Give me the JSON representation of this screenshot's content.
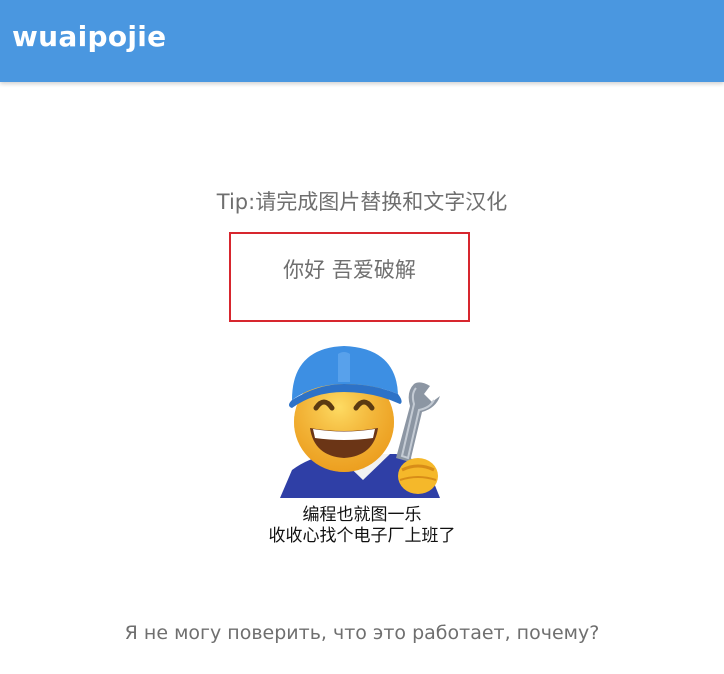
{
  "app_bar": {
    "title": "wuaipojie",
    "background_color": "#4a97e0"
  },
  "main": {
    "tip": "Tip:请完成图片替换和文字汉化",
    "greeting": "你好 吾爱破解",
    "highlight_color": "#d7262e",
    "meme": {
      "icon": "smiling-worker-with-wrench",
      "caption_line1": "编程也就图一乐",
      "caption_line2": "收收心找个电子厂上班了"
    },
    "russian_text": "Я не могу поверить, что это работает, почему?"
  }
}
